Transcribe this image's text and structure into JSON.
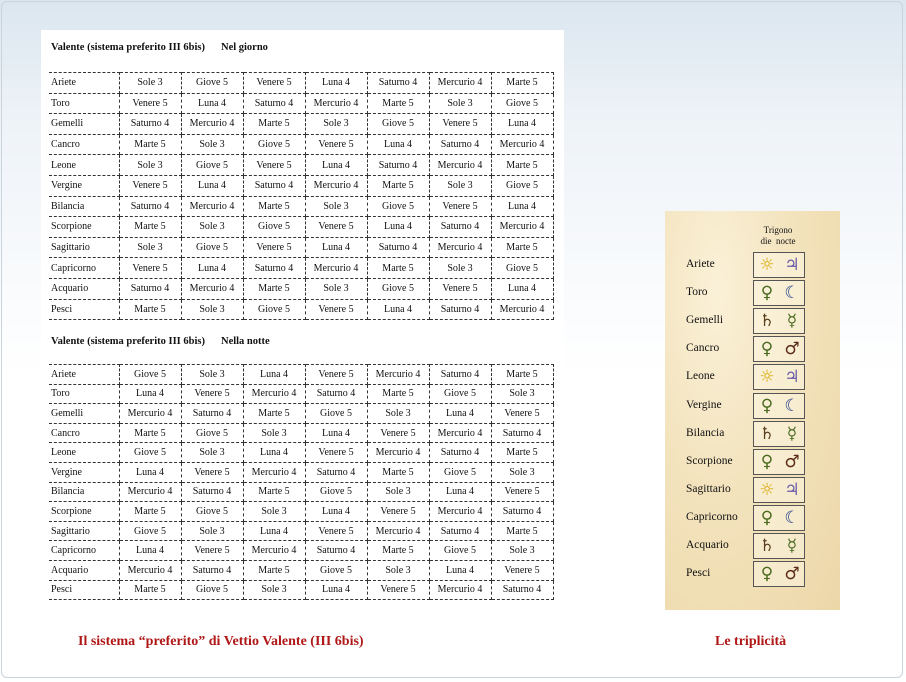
{
  "day_table": {
    "title": "Valente (sistema preferito III 6bis)",
    "subtitle": "Nel giorno",
    "rows": [
      {
        "sign": "Ariete",
        "cells": [
          "Sole 3",
          "Giove 5",
          "Venere 5",
          "Luna 4",
          "Saturno 4",
          "Mercurio 4",
          "Marte 5"
        ]
      },
      {
        "sign": "Toro",
        "cells": [
          "Venere 5",
          "Luna 4",
          "Saturno 4",
          "Mercurio 4",
          "Marte 5",
          "Sole 3",
          "Giove 5"
        ]
      },
      {
        "sign": "Gemelli",
        "cells": [
          "Saturno 4",
          "Mercurio 4",
          "Marte 5",
          "Sole 3",
          "Giove 5",
          "Venere 5",
          "Luna 4"
        ]
      },
      {
        "sign": "Cancro",
        "cells": [
          "Marte 5",
          "Sole 3",
          "Giove 5",
          "Venere 5",
          "Luna 4",
          "Saturno 4",
          "Mercurio 4"
        ]
      },
      {
        "sign": "Leone",
        "cells": [
          "Sole 3",
          "Giove 5",
          "Venere 5",
          "Luna 4",
          "Saturno 4",
          "Mercurio 4",
          "Marte 5"
        ]
      },
      {
        "sign": "Vergine",
        "cells": [
          "Venere 5",
          "Luna 4",
          "Saturno 4",
          "Mercurio 4",
          "Marte 5",
          "Sole 3",
          "Giove 5"
        ]
      },
      {
        "sign": "Bilancia",
        "cells": [
          "Saturno 4",
          "Mercurio 4",
          "Marte 5",
          "Sole 3",
          "Giove 5",
          "Venere 5",
          "Luna 4"
        ]
      },
      {
        "sign": "Scorpione",
        "cells": [
          "Marte 5",
          "Sole 3",
          "Giove 5",
          "Venere 5",
          "Luna 4",
          "Saturno 4",
          "Mercurio 4"
        ]
      },
      {
        "sign": "Sagittario",
        "cells": [
          "Sole 3",
          "Giove 5",
          "Venere 5",
          "Luna 4",
          "Saturno 4",
          "Mercurio 4",
          "Marte 5"
        ]
      },
      {
        "sign": "Capricorno",
        "cells": [
          "Venere 5",
          "Luna 4",
          "Saturno 4",
          "Mercurio 4",
          "Marte 5",
          "Sole 3",
          "Giove 5"
        ]
      },
      {
        "sign": "Acquario",
        "cells": [
          "Saturno 4",
          "Mercurio 4",
          "Marte 5",
          "Sole 3",
          "Giove 5",
          "Venere 5",
          "Luna 4"
        ]
      },
      {
        "sign": "Pesci",
        "cells": [
          "Marte 5",
          "Sole 3",
          "Giove 5",
          "Venere 5",
          "Luna 4",
          "Saturno 4",
          "Mercurio 4"
        ]
      }
    ]
  },
  "night_table": {
    "title": "Valente (sistema preferito III 6bis)",
    "subtitle": "Nella notte",
    "rows": [
      {
        "sign": "Ariete",
        "cells": [
          "Giove 5",
          "Sole 3",
          "Luna 4",
          "Venere 5",
          "Mercurio 4",
          "Saturno 4",
          "Marte 5"
        ]
      },
      {
        "sign": "Toro",
        "cells": [
          "Luna 4",
          "Venere 5",
          "Mercurio 4",
          "Saturno 4",
          "Marte 5",
          "Giove 5",
          "Sole 3"
        ]
      },
      {
        "sign": "Gemelli",
        "cells": [
          "Mercurio 4",
          "Saturno 4",
          "Marte 5",
          "Giove 5",
          "Sole 3",
          "Luna 4",
          "Venere 5"
        ]
      },
      {
        "sign": "Cancro",
        "cells": [
          "Marte 5",
          "Giove 5",
          "Sole 3",
          "Luna 4",
          "Venere 5",
          "Mercurio 4",
          "Saturno 4"
        ]
      },
      {
        "sign": "Leone",
        "cells": [
          "Giove 5",
          "Sole 3",
          "Luna 4",
          "Venere 5",
          "Mercurio 4",
          "Saturno 4",
          "Marte 5"
        ]
      },
      {
        "sign": "Vergine",
        "cells": [
          "Luna 4",
          "Venere 5",
          "Mercurio 4",
          "Saturno 4",
          "Marte 5",
          "Giove 5",
          "Sole 3"
        ]
      },
      {
        "sign": "Bilancia",
        "cells": [
          "Mercurio 4",
          "Saturno 4",
          "Marte 5",
          "Giove 5",
          "Sole 3",
          "Luna 4",
          "Venere 5"
        ]
      },
      {
        "sign": "Scorpione",
        "cells": [
          "Marte 5",
          "Giove 5",
          "Sole 3",
          "Luna 4",
          "Venere 5",
          "Mercurio 4",
          "Saturno 4"
        ]
      },
      {
        "sign": "Sagittario",
        "cells": [
          "Giove 5",
          "Sole 3",
          "Luna 4",
          "Venere 5",
          "Mercurio 4",
          "Saturno 4",
          "Marte 5"
        ]
      },
      {
        "sign": "Capricorno",
        "cells": [
          "Luna 4",
          "Venere 5",
          "Mercurio 4",
          "Saturno 4",
          "Marte 5",
          "Giove 5",
          "Sole 3"
        ]
      },
      {
        "sign": "Acquario",
        "cells": [
          "Mercurio 4",
          "Saturno 4",
          "Marte 5",
          "Giove 5",
          "Sole 3",
          "Luna 4",
          "Venere 5"
        ]
      },
      {
        "sign": "Pesci",
        "cells": [
          "Marte 5",
          "Giove 5",
          "Sole 3",
          "Luna 4",
          "Venere 5",
          "Mercurio 4",
          "Saturno 4"
        ]
      }
    ]
  },
  "triplicity": {
    "header_line1": "Trigono",
    "header_line2": "die  nocte",
    "rows": [
      {
        "sign": "Ariete",
        "day": "☼",
        "day_icon": "sun-icon",
        "night": "♃",
        "night_icon": "jupiter-icon"
      },
      {
        "sign": "Toro",
        "day": "♀",
        "day_icon": "venus-icon",
        "night": "☾",
        "night_icon": "moon-icon"
      },
      {
        "sign": "Gemelli",
        "day": "♄",
        "day_icon": "saturn-icon",
        "night": "☿",
        "night_icon": "mercury-icon"
      },
      {
        "sign": "Cancro",
        "day": "♀",
        "day_icon": "venus-icon",
        "night": "♂",
        "night_icon": "mars-icon"
      },
      {
        "sign": "Leone",
        "day": "☼",
        "day_icon": "sun-icon",
        "night": "♃",
        "night_icon": "jupiter-icon"
      },
      {
        "sign": "Vergine",
        "day": "♀",
        "day_icon": "venus-icon",
        "night": "☾",
        "night_icon": "moon-icon"
      },
      {
        "sign": "Bilancia",
        "day": "♄",
        "day_icon": "saturn-icon",
        "night": "☿",
        "night_icon": "mercury-icon"
      },
      {
        "sign": "Scorpione",
        "day": "♀",
        "day_icon": "venus-icon",
        "night": "♂",
        "night_icon": "mars-icon"
      },
      {
        "sign": "Sagittario",
        "day": "☼",
        "day_icon": "sun-icon",
        "night": "♃",
        "night_icon": "jupiter-icon"
      },
      {
        "sign": "Capricorno",
        "day": "♀",
        "day_icon": "venus-icon",
        "night": "☾",
        "night_icon": "moon-icon"
      },
      {
        "sign": "Acquario",
        "day": "♄",
        "day_icon": "saturn-icon",
        "night": "☿",
        "night_icon": "mercury-icon"
      },
      {
        "sign": "Pesci",
        "day": "♀",
        "day_icon": "venus-icon",
        "night": "♂",
        "night_icon": "mars-icon"
      }
    ]
  },
  "captions": {
    "left": "Il sistema “preferito” di Vettio Valente (III 6bis)",
    "right": "Le triplicità"
  },
  "colors": {
    "caption": "#b01717",
    "parchment": "#f3e3bd"
  }
}
